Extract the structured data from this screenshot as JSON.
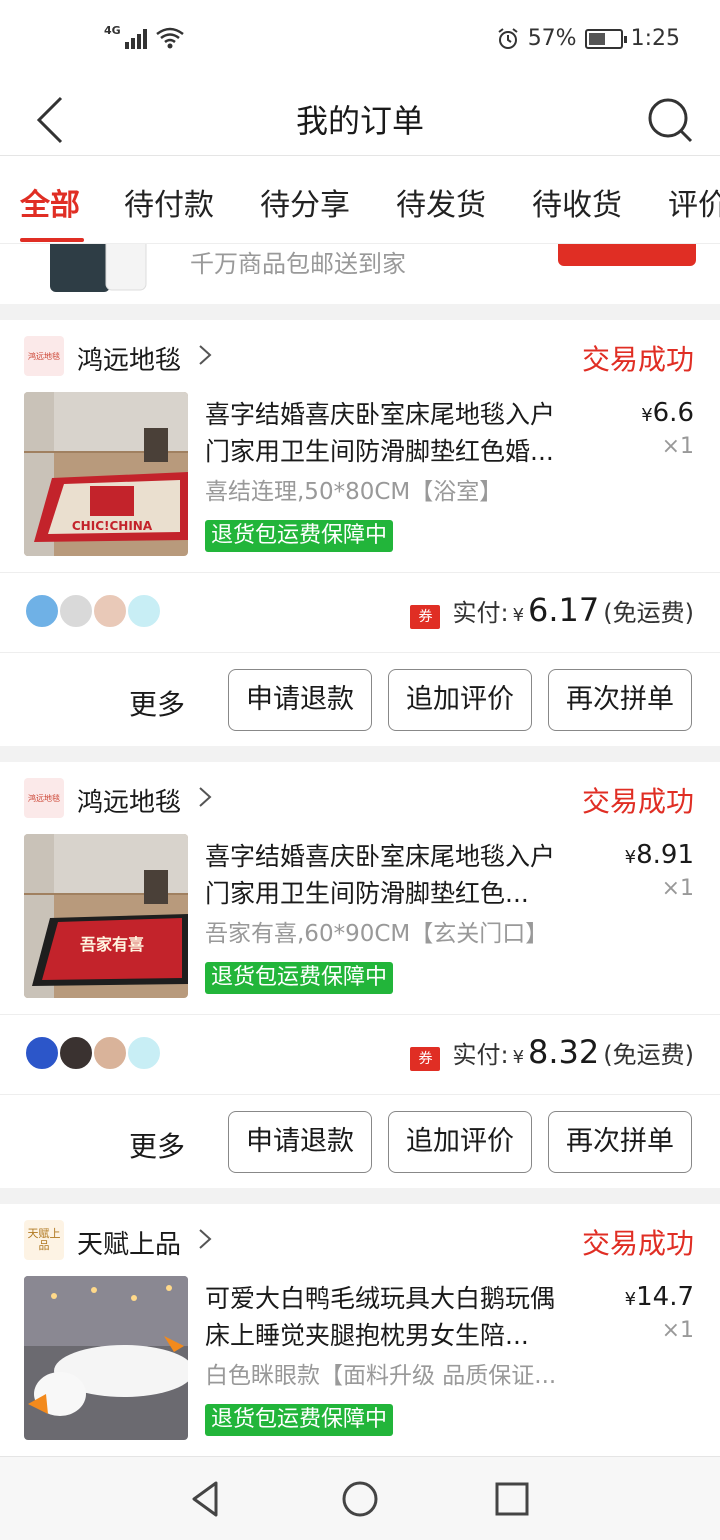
{
  "status_bar": {
    "network": "4G",
    "battery_percent": "57%",
    "battery_level": 0.57,
    "time": "1:25"
  },
  "header": {
    "title": "我的订单"
  },
  "tabs": [
    {
      "label": "全部",
      "active": true
    },
    {
      "label": "待付款"
    },
    {
      "label": "待分享"
    },
    {
      "label": "待发货"
    },
    {
      "label": "待收货"
    },
    {
      "label": "评价"
    }
  ],
  "promo": {
    "text": "千万商品包邮送到家"
  },
  "orders": [
    {
      "store": "鸿远地毯",
      "logo_text": "鸿远地毯",
      "status": "交易成功",
      "title_line1": "喜字结婚喜庆卧室床尾地毯入户",
      "title_line2": "门家用卫生间防滑脚垫红色婚...",
      "spec": "喜结连理,50*80CM【浴室】",
      "badge": "退货包运费保障中",
      "price_symbol": "¥",
      "price": "6.6",
      "qty": "×1",
      "coupon": "券",
      "pay_label": "实付:",
      "pay_amount": "6.17",
      "shipping_note": "(免运费)",
      "rug_text": "CHIC!CHINA",
      "more_label": "更多",
      "buttons": [
        "申请退款",
        "追加评价",
        "再次拼单"
      ]
    },
    {
      "store": "鸿远地毯",
      "logo_text": "鸿远地毯",
      "status": "交易成功",
      "title_line1": "喜字结婚喜庆卧室床尾地毯入户",
      "title_line2": "门家用卫生间防滑脚垫红色...",
      "spec": "吾家有喜,60*90CM【玄关门口】",
      "badge": "退货包运费保障中",
      "price_symbol": "¥",
      "price": "8.91",
      "qty": "×1",
      "coupon": "券",
      "pay_label": "实付:",
      "pay_amount": "8.32",
      "shipping_note": "(免运费)",
      "rug_text": "吾家有喜",
      "more_label": "更多",
      "buttons": [
        "申请退款",
        "追加评价",
        "再次拼单"
      ]
    },
    {
      "store": "天赋上品",
      "logo_text": "天赋上品",
      "status": "交易成功",
      "title_line1": "可爱大白鸭毛绒玩具大白鹅玩偶",
      "title_line2": "床上睡觉夹腿抱枕男女生陪...",
      "spec": "白色眯眼款【面料升级 品质保证...",
      "badge": "退货包运费保障中",
      "price_symbol": "¥",
      "price": "14.7",
      "qty": "×1"
    }
  ],
  "colors": {
    "accent": "#e02e24",
    "badge_green": "#22b53a"
  },
  "icons": {
    "back": "chevron-left-icon",
    "search": "search-icon",
    "nav_back": "triangle-back-icon",
    "nav_home": "circle-home-icon",
    "nav_recent": "square-recent-icon"
  }
}
